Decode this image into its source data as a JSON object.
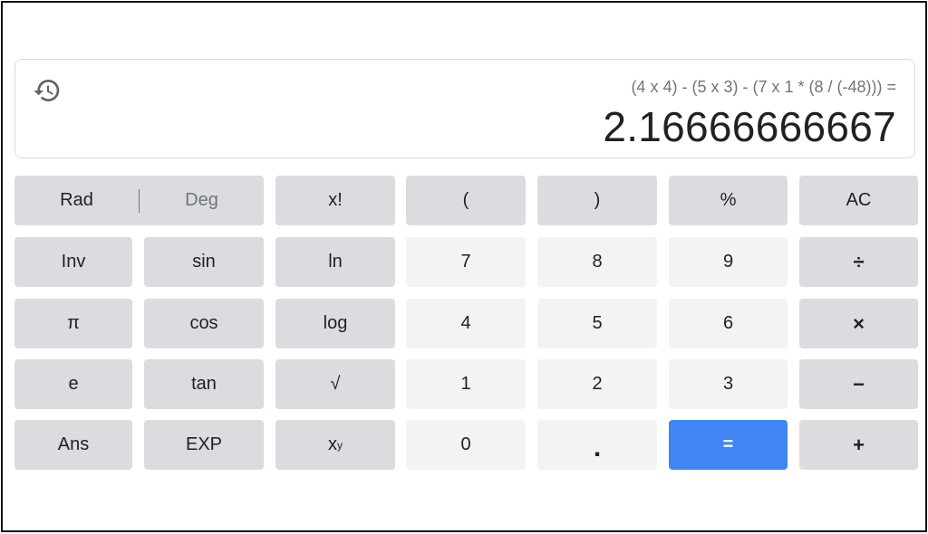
{
  "display": {
    "expression": "(4 x 4) - (5 x 3) - (7 x 1 * (8 / (-48))) =",
    "result": "2.16666666667",
    "history_icon": "history-icon"
  },
  "keys": {
    "rad": "Rad",
    "deg": "Deg",
    "fact": "x!",
    "lparen": "(",
    "rparen": ")",
    "percent": "%",
    "ac": "AC",
    "inv": "Inv",
    "sin": "sin",
    "ln": "ln",
    "n7": "7",
    "n8": "8",
    "n9": "9",
    "divide": "÷",
    "pi": "π",
    "cos": "cos",
    "log": "log",
    "n4": "4",
    "n5": "5",
    "n6": "6",
    "multiply": "×",
    "e": "e",
    "tan": "tan",
    "sqrt": "√",
    "n1": "1",
    "n2": "2",
    "n3": "3",
    "minus": "−",
    "ans": "Ans",
    "exp": "EXP",
    "pow_base": "x",
    "pow_exp": "y",
    "n0": "0",
    "dot": ".",
    "equals": "=",
    "plus": "+"
  },
  "colors": {
    "key_dark": "#dadce0",
    "key_light": "#f1f3f4",
    "equals": "#4285f4",
    "text": "#202124",
    "muted": "#70757a"
  }
}
